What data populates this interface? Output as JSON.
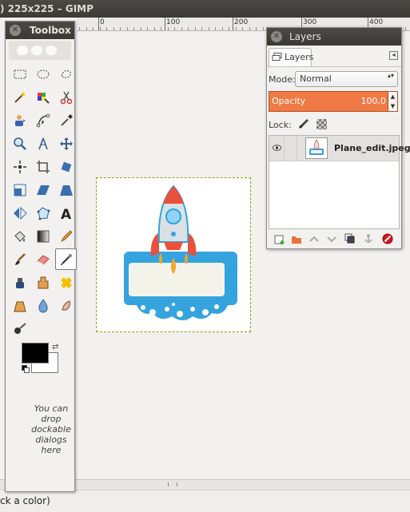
{
  "window": {
    "title": ") 225x225 – GIMP",
    "status_text": "ck a color)"
  },
  "ruler": {
    "labels": [
      "0",
      "100",
      "200",
      "300",
      "400"
    ]
  },
  "toolbox": {
    "title": "Toolbox",
    "close_symbol": "✕",
    "drop_hint": "You can drop dockable dialogs here",
    "foreground_color": "#000000",
    "background_color": "#ffffff",
    "tools": [
      {
        "name": "rect-select-icon"
      },
      {
        "name": "ellipse-select-icon"
      },
      {
        "name": "free-select-icon"
      },
      {
        "name": "fuzzy-select-icon"
      },
      {
        "name": "select-by-color-icon"
      },
      {
        "name": "scissors-select-icon"
      },
      {
        "name": "foreground-select-icon"
      },
      {
        "name": "paths-icon"
      },
      {
        "name": "color-picker-icon"
      },
      {
        "name": "zoom-icon"
      },
      {
        "name": "measure-icon"
      },
      {
        "name": "move-icon"
      },
      {
        "name": "align-icon"
      },
      {
        "name": "crop-icon"
      },
      {
        "name": "rotate-icon"
      },
      {
        "name": "scale-icon"
      },
      {
        "name": "shear-icon"
      },
      {
        "name": "perspective-icon"
      },
      {
        "name": "flip-icon"
      },
      {
        "name": "cage-transform-icon"
      },
      {
        "name": "text-icon"
      },
      {
        "name": "bucket-fill-icon"
      },
      {
        "name": "blend-icon"
      },
      {
        "name": "pencil-icon"
      },
      {
        "name": "paintbrush-icon"
      },
      {
        "name": "eraser-icon"
      },
      {
        "name": "airbrush-icon"
      },
      {
        "name": "ink-icon"
      },
      {
        "name": "clone-icon"
      },
      {
        "name": "heal-icon"
      },
      {
        "name": "perspective-clone-icon"
      },
      {
        "name": "blur-icon"
      },
      {
        "name": "smudge-icon"
      },
      {
        "name": "dodge-burn-icon"
      }
    ],
    "active_tool_index": 26
  },
  "layers": {
    "title": "Layers",
    "close_symbol": "✕",
    "tab_label": "Layers",
    "tab_menu_symbol": "◂",
    "mode_label": "Mode:",
    "mode_value": "Normal",
    "select_arrow": "▴▾",
    "opacity_label": "Opacity",
    "opacity_value": "100,0",
    "spin_up": "▲",
    "spin_down": "▼",
    "lock_label": "Lock:",
    "accent_color": "#ef7a45",
    "layer_items": [
      {
        "name": "Plane_edit.jpeg"
      }
    ],
    "buttons": [
      "new-layer-icon",
      "new-group-icon",
      "raise-layer-icon",
      "lower-layer-icon",
      "duplicate-layer-icon",
      "anchor-layer-icon",
      "delete-layer-icon"
    ]
  },
  "canvas": {
    "image_colors": {
      "rocket_body": "#d9e1e6",
      "rocket_red": "#e8513c",
      "frame_blue": "#35a3de",
      "flame": "#f5a623"
    }
  }
}
